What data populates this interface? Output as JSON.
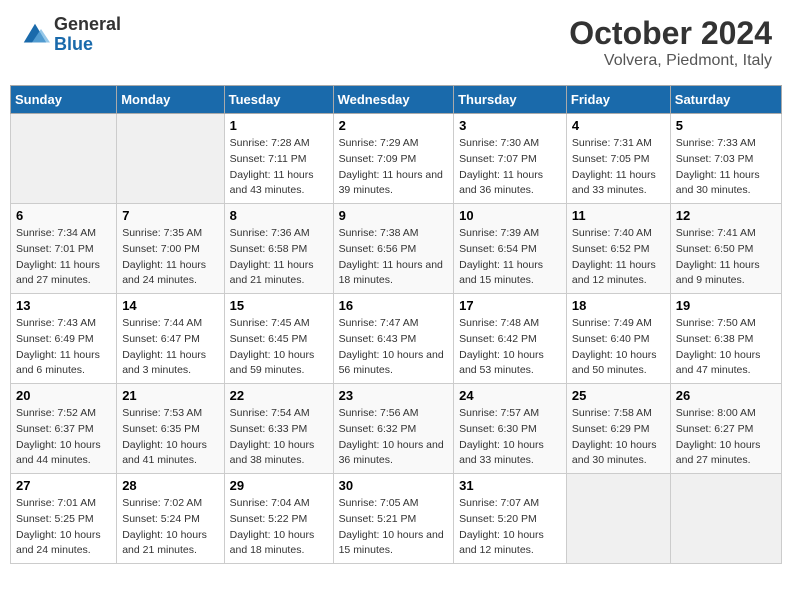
{
  "header": {
    "logo_general": "General",
    "logo_blue": "Blue",
    "month_title": "October 2024",
    "location": "Volvera, Piedmont, Italy"
  },
  "days_of_week": [
    "Sunday",
    "Monday",
    "Tuesday",
    "Wednesday",
    "Thursday",
    "Friday",
    "Saturday"
  ],
  "weeks": [
    [
      {
        "day": "",
        "sunrise": "",
        "sunset": "",
        "daylight": ""
      },
      {
        "day": "",
        "sunrise": "",
        "sunset": "",
        "daylight": ""
      },
      {
        "day": "1",
        "sunrise": "Sunrise: 7:28 AM",
        "sunset": "Sunset: 7:11 PM",
        "daylight": "Daylight: 11 hours and 43 minutes."
      },
      {
        "day": "2",
        "sunrise": "Sunrise: 7:29 AM",
        "sunset": "Sunset: 7:09 PM",
        "daylight": "Daylight: 11 hours and 39 minutes."
      },
      {
        "day": "3",
        "sunrise": "Sunrise: 7:30 AM",
        "sunset": "Sunset: 7:07 PM",
        "daylight": "Daylight: 11 hours and 36 minutes."
      },
      {
        "day": "4",
        "sunrise": "Sunrise: 7:31 AM",
        "sunset": "Sunset: 7:05 PM",
        "daylight": "Daylight: 11 hours and 33 minutes."
      },
      {
        "day": "5",
        "sunrise": "Sunrise: 7:33 AM",
        "sunset": "Sunset: 7:03 PM",
        "daylight": "Daylight: 11 hours and 30 minutes."
      }
    ],
    [
      {
        "day": "6",
        "sunrise": "Sunrise: 7:34 AM",
        "sunset": "Sunset: 7:01 PM",
        "daylight": "Daylight: 11 hours and 27 minutes."
      },
      {
        "day": "7",
        "sunrise": "Sunrise: 7:35 AM",
        "sunset": "Sunset: 7:00 PM",
        "daylight": "Daylight: 11 hours and 24 minutes."
      },
      {
        "day": "8",
        "sunrise": "Sunrise: 7:36 AM",
        "sunset": "Sunset: 6:58 PM",
        "daylight": "Daylight: 11 hours and 21 minutes."
      },
      {
        "day": "9",
        "sunrise": "Sunrise: 7:38 AM",
        "sunset": "Sunset: 6:56 PM",
        "daylight": "Daylight: 11 hours and 18 minutes."
      },
      {
        "day": "10",
        "sunrise": "Sunrise: 7:39 AM",
        "sunset": "Sunset: 6:54 PM",
        "daylight": "Daylight: 11 hours and 15 minutes."
      },
      {
        "day": "11",
        "sunrise": "Sunrise: 7:40 AM",
        "sunset": "Sunset: 6:52 PM",
        "daylight": "Daylight: 11 hours and 12 minutes."
      },
      {
        "day": "12",
        "sunrise": "Sunrise: 7:41 AM",
        "sunset": "Sunset: 6:50 PM",
        "daylight": "Daylight: 11 hours and 9 minutes."
      }
    ],
    [
      {
        "day": "13",
        "sunrise": "Sunrise: 7:43 AM",
        "sunset": "Sunset: 6:49 PM",
        "daylight": "Daylight: 11 hours and 6 minutes."
      },
      {
        "day": "14",
        "sunrise": "Sunrise: 7:44 AM",
        "sunset": "Sunset: 6:47 PM",
        "daylight": "Daylight: 11 hours and 3 minutes."
      },
      {
        "day": "15",
        "sunrise": "Sunrise: 7:45 AM",
        "sunset": "Sunset: 6:45 PM",
        "daylight": "Daylight: 10 hours and 59 minutes."
      },
      {
        "day": "16",
        "sunrise": "Sunrise: 7:47 AM",
        "sunset": "Sunset: 6:43 PM",
        "daylight": "Daylight: 10 hours and 56 minutes."
      },
      {
        "day": "17",
        "sunrise": "Sunrise: 7:48 AM",
        "sunset": "Sunset: 6:42 PM",
        "daylight": "Daylight: 10 hours and 53 minutes."
      },
      {
        "day": "18",
        "sunrise": "Sunrise: 7:49 AM",
        "sunset": "Sunset: 6:40 PM",
        "daylight": "Daylight: 10 hours and 50 minutes."
      },
      {
        "day": "19",
        "sunrise": "Sunrise: 7:50 AM",
        "sunset": "Sunset: 6:38 PM",
        "daylight": "Daylight: 10 hours and 47 minutes."
      }
    ],
    [
      {
        "day": "20",
        "sunrise": "Sunrise: 7:52 AM",
        "sunset": "Sunset: 6:37 PM",
        "daylight": "Daylight: 10 hours and 44 minutes."
      },
      {
        "day": "21",
        "sunrise": "Sunrise: 7:53 AM",
        "sunset": "Sunset: 6:35 PM",
        "daylight": "Daylight: 10 hours and 41 minutes."
      },
      {
        "day": "22",
        "sunrise": "Sunrise: 7:54 AM",
        "sunset": "Sunset: 6:33 PM",
        "daylight": "Daylight: 10 hours and 38 minutes."
      },
      {
        "day": "23",
        "sunrise": "Sunrise: 7:56 AM",
        "sunset": "Sunset: 6:32 PM",
        "daylight": "Daylight: 10 hours and 36 minutes."
      },
      {
        "day": "24",
        "sunrise": "Sunrise: 7:57 AM",
        "sunset": "Sunset: 6:30 PM",
        "daylight": "Daylight: 10 hours and 33 minutes."
      },
      {
        "day": "25",
        "sunrise": "Sunrise: 7:58 AM",
        "sunset": "Sunset: 6:29 PM",
        "daylight": "Daylight: 10 hours and 30 minutes."
      },
      {
        "day": "26",
        "sunrise": "Sunrise: 8:00 AM",
        "sunset": "Sunset: 6:27 PM",
        "daylight": "Daylight: 10 hours and 27 minutes."
      }
    ],
    [
      {
        "day": "27",
        "sunrise": "Sunrise: 7:01 AM",
        "sunset": "Sunset: 5:25 PM",
        "daylight": "Daylight: 10 hours and 24 minutes."
      },
      {
        "day": "28",
        "sunrise": "Sunrise: 7:02 AM",
        "sunset": "Sunset: 5:24 PM",
        "daylight": "Daylight: 10 hours and 21 minutes."
      },
      {
        "day": "29",
        "sunrise": "Sunrise: 7:04 AM",
        "sunset": "Sunset: 5:22 PM",
        "daylight": "Daylight: 10 hours and 18 minutes."
      },
      {
        "day": "30",
        "sunrise": "Sunrise: 7:05 AM",
        "sunset": "Sunset: 5:21 PM",
        "daylight": "Daylight: 10 hours and 15 minutes."
      },
      {
        "day": "31",
        "sunrise": "Sunrise: 7:07 AM",
        "sunset": "Sunset: 5:20 PM",
        "daylight": "Daylight: 10 hours and 12 minutes."
      },
      {
        "day": "",
        "sunrise": "",
        "sunset": "",
        "daylight": ""
      },
      {
        "day": "",
        "sunrise": "",
        "sunset": "",
        "daylight": ""
      }
    ]
  ]
}
